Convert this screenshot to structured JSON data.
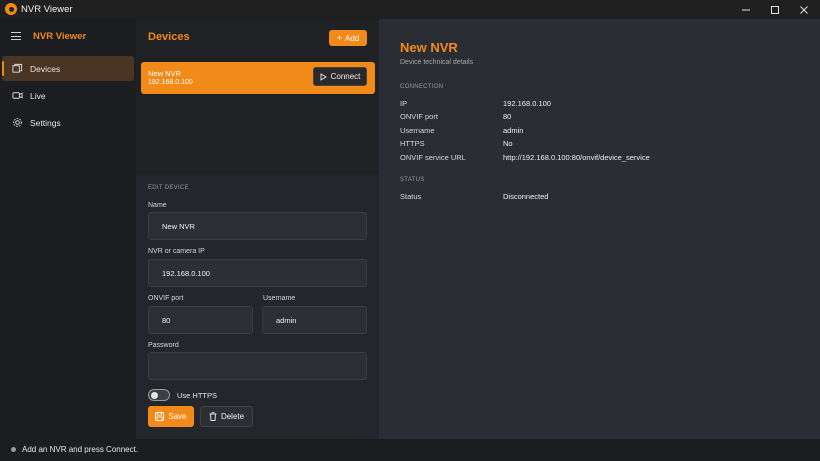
{
  "window": {
    "title": "NVR Viewer",
    "accent": "#f28a1a"
  },
  "sidebar": {
    "brand": "NVR Viewer",
    "items": [
      {
        "label": "Devices",
        "icon": "devices-icon",
        "active": true
      },
      {
        "label": "Live",
        "icon": "camera-icon",
        "active": false
      },
      {
        "label": "Settings",
        "icon": "gear-icon",
        "active": false
      }
    ]
  },
  "devices": {
    "title": "Devices",
    "add_label": "Add",
    "list": [
      {
        "name": "New NVR",
        "ip": "192.168.0.100",
        "connect_label": "Connect",
        "selected": true
      }
    ]
  },
  "edit": {
    "section_label": "EDIT DEVICE",
    "name_label": "Name",
    "name_value": "New NVR",
    "ip_label": "NVR or camera IP",
    "ip_value": "192.168.0.100",
    "port_label": "ONVIF port",
    "port_value": "80",
    "username_label": "Username",
    "username_value": "admin",
    "password_label": "Password",
    "password_value": "",
    "https_label": "Use HTTPS",
    "https_on": false,
    "save_label": "Save",
    "delete_label": "Delete"
  },
  "details": {
    "title": "New NVR",
    "subtitle": "Device technical details",
    "connection_header": "CONNECTION",
    "connection": [
      {
        "key": "IP",
        "value": "192.168.0.100"
      },
      {
        "key": "ONVIF port",
        "value": "80"
      },
      {
        "key": "Username",
        "value": "admin"
      },
      {
        "key": "HTTPS",
        "value": "No"
      },
      {
        "key": "ONVIF service URL",
        "value": "http://192.168.0.100:80/onvif/device_service"
      }
    ],
    "status_header": "STATUS",
    "status": [
      {
        "key": "Status",
        "value": "Disconnected"
      }
    ]
  },
  "statusbar": {
    "text": "Add an NVR and press Connect."
  }
}
